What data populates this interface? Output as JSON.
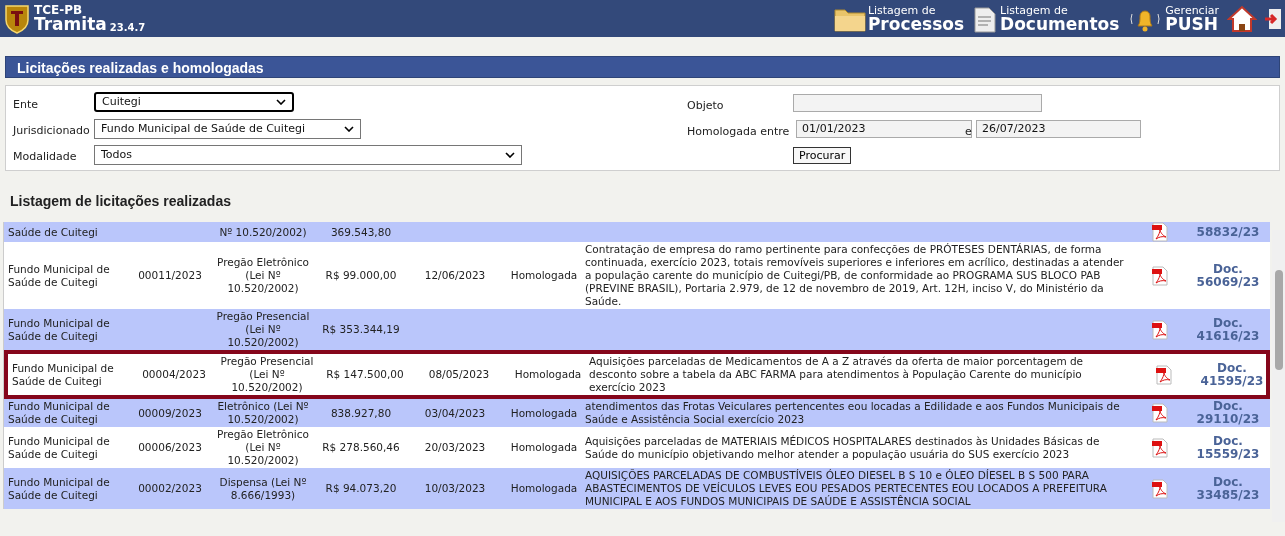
{
  "header": {
    "org": "TCE-PB",
    "app": "Tramita",
    "version": "23.4.7",
    "nav": [
      {
        "kind": "folder",
        "top": "Listagem de",
        "bottom": "Processos"
      },
      {
        "kind": "document",
        "top": "Listagem de",
        "bottom": "Documentos"
      },
      {
        "kind": "bell",
        "top": "Gerenciar",
        "bottom": "PUSH"
      },
      {
        "kind": "home"
      },
      {
        "kind": "exit"
      }
    ]
  },
  "panel_title": "Licitações realizadas e homologadas",
  "filters": {
    "ente": {
      "label": "Ente",
      "value": "Cuitegi",
      "focused": true
    },
    "jurisdicionado": {
      "label": "Jurisdicionado",
      "value": "Fundo Municipal de Saúde de Cuitegi"
    },
    "modalidade": {
      "label": "Modalidade",
      "value": "Todos"
    },
    "objeto": {
      "label": "Objeto"
    },
    "homologada": {
      "label": "Homologada entre",
      "from": "01/01/2023",
      "sep": "e",
      "to": "26/07/2023"
    },
    "button": "Procurar"
  },
  "list_title": "Listagem de licitações realizadas",
  "rows": [
    {
      "entity": "Saúde de Cuitegi",
      "number": "",
      "modality": "Nº 10.520/2002)",
      "value": "369.543,80",
      "date": "",
      "status": "",
      "object": "",
      "doc": "58832/23",
      "highlighted": false
    },
    {
      "entity": "Fundo Municipal de Saúde de Cuitegi",
      "number": "00011/2023",
      "modality": "Pregão Eletrônico (Lei Nº 10.520/2002)",
      "value": "R$ 99.000,00",
      "date": "12/06/2023",
      "status": "Homologada",
      "object": "Contratação de empresa do ramo pertinente para confecções de PRÓTESES DENTÁRIAS, de forma continuada, exercício 2023, totais removíveis superiores e inferiores em acrílico, destinadas a atender a população carente do município de Cuitegi/PB, de conformidade ao PROGRAMA SUS BLOCO PAB (PREVINE BRASIL), Portaria 2.979, de 12 de novembro de 2019, Art. 12H, inciso V, do Ministério da Saúde.",
      "doc": "Doc. 56069/23",
      "highlighted": false
    },
    {
      "entity": "Fundo Municipal de Saúde de Cuitegi",
      "number": "",
      "modality": "Pregão Presencial (Lei Nº 10.520/2002)",
      "value": "R$ 353.344,19",
      "date": "",
      "status": "",
      "object": "",
      "doc": "Doc. 41616/23",
      "highlighted": false
    },
    {
      "entity": "Fundo Municipal de Saúde de Cuitegi",
      "number": "00004/2023",
      "modality": "Pregão Presencial (Lei Nº 10.520/2002)",
      "value": "R$ 147.500,00",
      "date": "08/05/2023",
      "status": "Homologada",
      "object": "Aquisições parceladas de Medicamentos de A a Z através da oferta de maior porcentagem de desconto sobre a tabela da ABC FARMA para atendimentos à População Carente do município exercício 2023",
      "doc": "Doc. 41595/23",
      "highlighted": true
    },
    {
      "entity": "Fundo Municipal de Saúde de Cuitegi",
      "number": "00009/2023",
      "modality": "Eletrônico (Lei Nº 10.520/2002)",
      "value": "838.927,80",
      "date": "03/04/2023",
      "status": "Homologada",
      "object": "atendimentos das Frotas Veiculares pertencentes eou locadas a Edilidade e aos Fundos Municipais de Saúde e Assistência Social exercício 2023",
      "doc": "Doc. 29110/23",
      "highlighted": false
    },
    {
      "entity": "Fundo Municipal de Saúde de Cuitegi",
      "number": "00006/2023",
      "modality": "Pregão Eletrônico (Lei Nº 10.520/2002)",
      "value": "R$ 278.560,46",
      "date": "20/03/2023",
      "status": "Homologada",
      "object": "Aquisições parceladas de MATERIAIS MÉDICOS HOSPITALARES destinados às Unidades Básicas de Saúde do município objetivando melhor atender a população usuária do SUS exercício 2023",
      "doc": "Doc. 15559/23",
      "highlighted": false
    },
    {
      "entity": "Fundo Municipal de Saúde de Cuitegi",
      "number": "00002/2023",
      "modality": "Dispensa (Lei Nº 8.666/1993)",
      "value": "R$ 94.073,20",
      "date": "10/03/2023",
      "status": "Homologada",
      "object": "AQUISIÇÕES PARCELADAS DE COMBUSTÍVEIS ÓLEO DIESEL B S 10 e ÓLEO DÍESEL B S 500 PARA ABASTECIMENTOS DE VEÍCULOS LEVES EOU PESADOS PERTECENTES EOU LOCADOS A PREFEITURA MUNICIPAL E AOS FUNDOS MUNICIPAIS DE SAÚDE E ASSISTÊNCIA SOCIAL",
      "doc": "Doc. 33485/23",
      "highlighted": false
    }
  ]
}
